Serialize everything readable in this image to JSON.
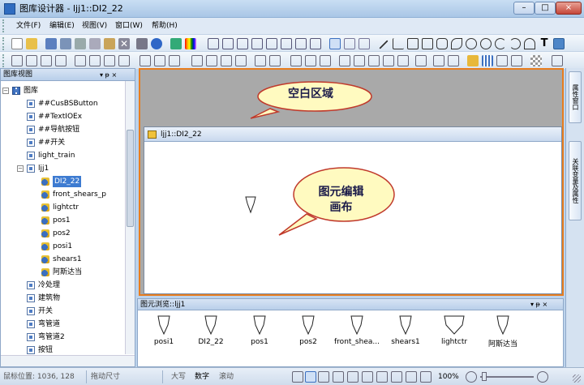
{
  "window": {
    "title": "图库设计器 - ljj1::DI2_22",
    "min": "–",
    "max": "□",
    "close": "×"
  },
  "menu": [
    "文件(F)",
    "编辑(E)",
    "视图(V)",
    "窗口(W)",
    "帮助(H)"
  ],
  "left_panel": {
    "title": "图库视图",
    "pin": "▾ ᵽ ×",
    "tree": [
      {
        "label": "图库",
        "level": 0,
        "icon": "library-icon",
        "expander": "−"
      },
      {
        "label": "##CusBSButton",
        "level": 1,
        "icon": "picture-icon"
      },
      {
        "label": "##TextIOEx",
        "level": 1,
        "icon": "picture-icon"
      },
      {
        "label": "##导航按钮",
        "level": 1,
        "icon": "picture-icon"
      },
      {
        "label": "##开关",
        "level": 1,
        "icon": "picture-icon"
      },
      {
        "label": "light_train",
        "level": 1,
        "icon": "picture-icon"
      },
      {
        "label": "ljj1",
        "level": 1,
        "icon": "picture-icon",
        "expander": "−"
      },
      {
        "label": "DI2_22",
        "level": 2,
        "icon": "shape-icon",
        "selected": true
      },
      {
        "label": "front_shears_p",
        "level": 2,
        "icon": "shape-icon"
      },
      {
        "label": "lightctr",
        "level": 2,
        "icon": "shape-icon"
      },
      {
        "label": "pos1",
        "level": 2,
        "icon": "shape-icon"
      },
      {
        "label": "pos2",
        "level": 2,
        "icon": "shape-icon"
      },
      {
        "label": "posi1",
        "level": 2,
        "icon": "shape-icon"
      },
      {
        "label": "shears1",
        "level": 2,
        "icon": "shape-icon"
      },
      {
        "label": "阿斯达当",
        "level": 2,
        "icon": "shape-icon"
      },
      {
        "label": "冷处理",
        "level": 1,
        "icon": "picture-icon"
      },
      {
        "label": "建筑物",
        "level": 1,
        "icon": "picture-icon"
      },
      {
        "label": "开关",
        "level": 1,
        "icon": "picture-icon"
      },
      {
        "label": "弯管道",
        "level": 1,
        "icon": "picture-icon"
      },
      {
        "label": "弯管道2",
        "level": 1,
        "icon": "picture-icon"
      },
      {
        "label": "按钮",
        "level": 1,
        "icon": "picture-icon"
      }
    ]
  },
  "workspace": {
    "callout_blank": "空白区域",
    "doc_title": "ljj1::DI2_22",
    "callout_canvas_line1": "图元编辑",
    "callout_canvas_line2": "画布"
  },
  "right_tabs": [
    "属性窗口",
    "关联变量及属性"
  ],
  "bottom_panel": {
    "title": "图元浏览::ljj1",
    "pin": "▾ ᵽ ×",
    "items": [
      "posi1",
      "DI2_22",
      "pos1",
      "pos2",
      "front_shea...",
      "shears1",
      "lightctr",
      "阿斯达当"
    ]
  },
  "status": {
    "mouse": "鼠标位置: 1036, 128",
    "drag": "拖动尺寸",
    "caps": "大写",
    "num": "数字",
    "scroll": "滚动",
    "zoom": "100%"
  }
}
